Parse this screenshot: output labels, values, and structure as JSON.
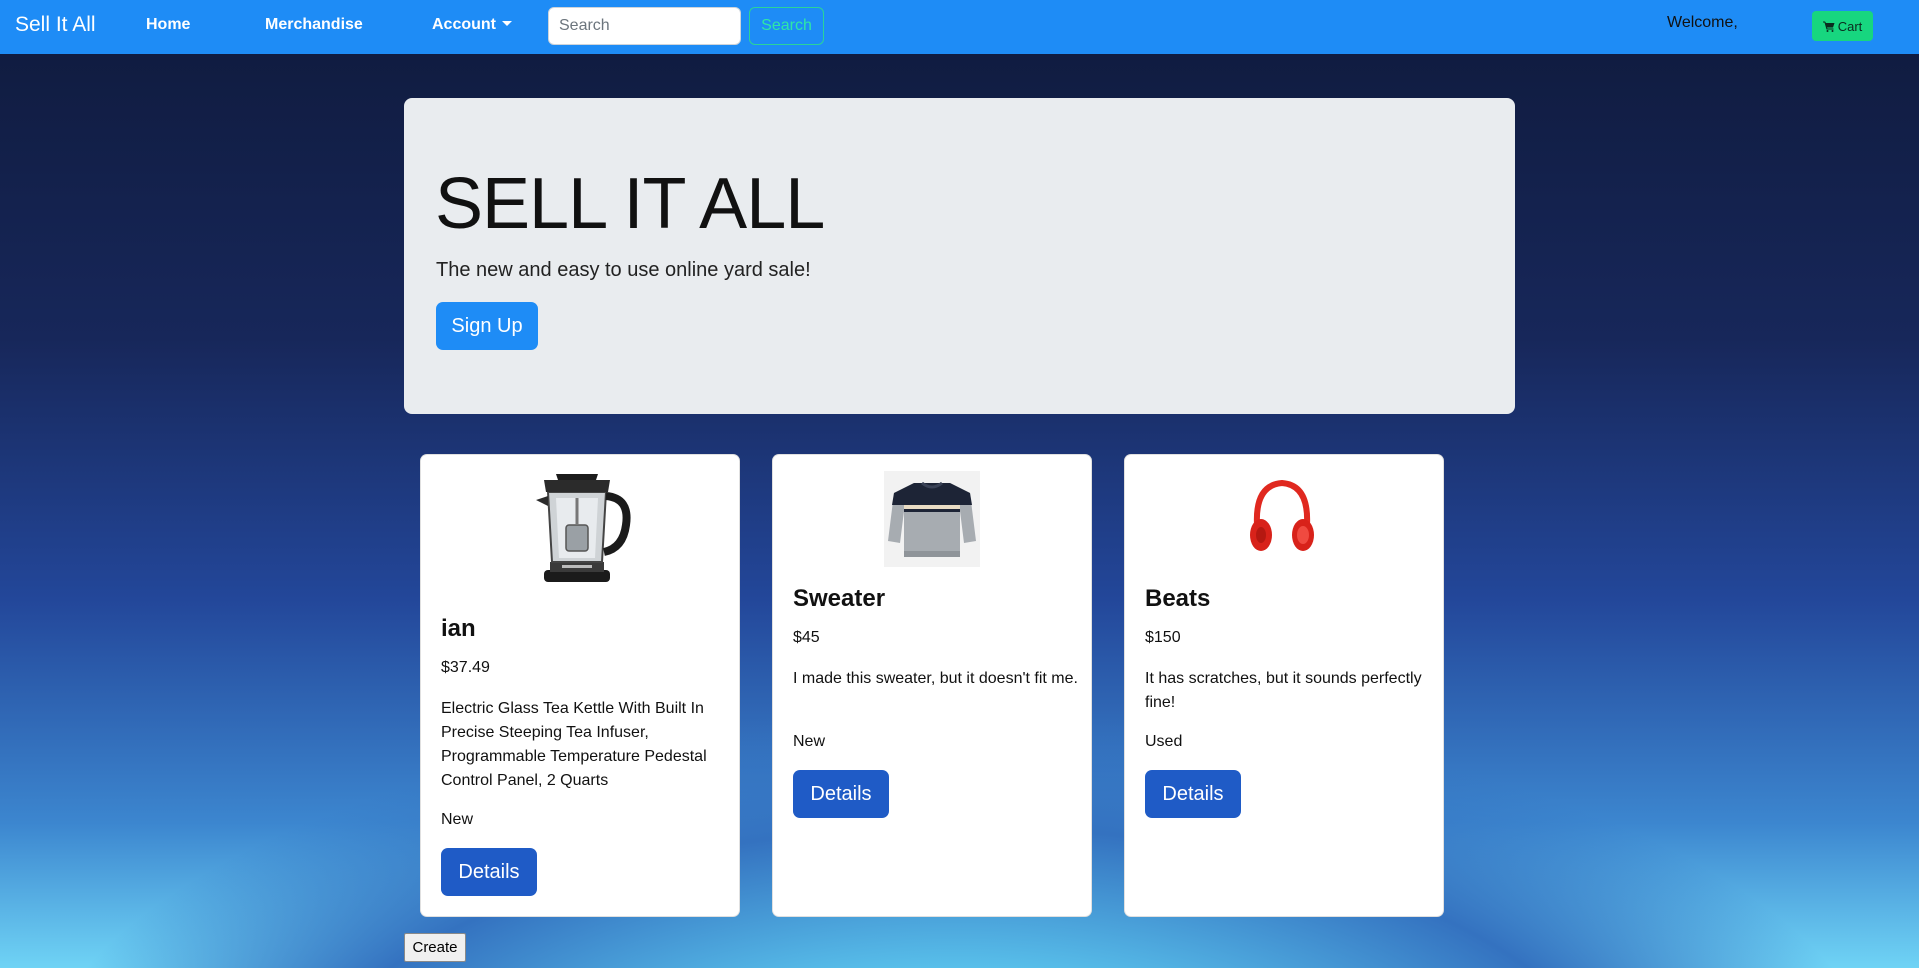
{
  "navbar": {
    "brand": "Sell It All",
    "links": {
      "home": "Home",
      "merchandise": "Merchandise",
      "account": "Account"
    },
    "search": {
      "placeholder": "Search",
      "value": "",
      "button_label": "Search"
    },
    "welcome_text": "Welcome,",
    "cart_label": "Cart",
    "cart_icon": "shopping-cart-icon"
  },
  "jumbotron": {
    "title": "SELL IT ALL",
    "lead": "The new and easy to use online yard sale!",
    "signup_label": "Sign Up"
  },
  "products": [
    {
      "name": "ian",
      "price": "$37.49",
      "description": "Electric Glass Tea Kettle With Built In Precise Steeping Tea Infuser, Programmable Temperature Pedestal Control Panel, 2 Quarts",
      "condition": "New",
      "details_label": "Details",
      "image": "tea-kettle"
    },
    {
      "name": "Sweater",
      "price": "$45",
      "description": "I made this sweater, but it doesn't fit me.",
      "condition": "New",
      "details_label": "Details",
      "image": "sweater"
    },
    {
      "name": "Beats",
      "price": "$150",
      "description": "It has scratches, but it sounds perfectly fine!",
      "condition": "Used",
      "details_label": "Details",
      "image": "red-headphones"
    }
  ],
  "create_label": "Create",
  "colors": {
    "navbar": "#1e8cf6",
    "jumbotron": "#e9ecef",
    "primary_button": "#1e8cf6",
    "details_button": "#1f5bc6",
    "cart_button": "#17d67f",
    "search_outline": "#2ad39a"
  }
}
